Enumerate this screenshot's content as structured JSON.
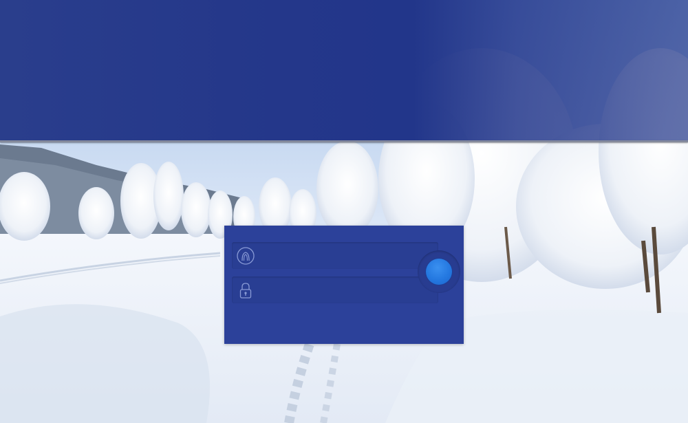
{
  "login": {
    "username_placeholder": "",
    "username_value": "",
    "password_placeholder": "",
    "password_value": "",
    "submit_label": ""
  },
  "icons": {
    "username": "user-icon",
    "password": "lock-icon",
    "submit": "submit-button"
  },
  "colors": {
    "header": "#22368a",
    "panel": "#2c419a",
    "field": "#293e93",
    "submit": "#2478e0"
  }
}
